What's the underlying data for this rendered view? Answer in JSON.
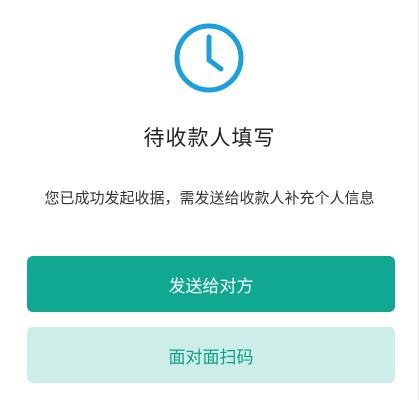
{
  "status": {
    "icon": "clock-icon",
    "title": "待收款人填写",
    "description": "您已成功发起收据，需发送给收款人补充个人信息"
  },
  "actions": {
    "send_label": "发送给对方",
    "scan_label": "面对面扫码"
  },
  "colors": {
    "accent": "#1a9fe0",
    "primary_button": "#10a891",
    "secondary_button": "#cdeee8",
    "secondary_text": "#0d9f88"
  }
}
